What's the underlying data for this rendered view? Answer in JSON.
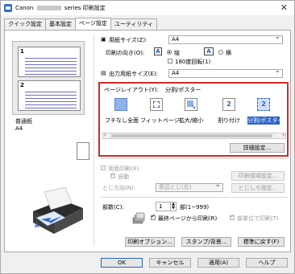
{
  "window": {
    "title_prefix": "Canon",
    "title_suffix": "series 印刷設定",
    "close": "✕"
  },
  "tabs": [
    "クイック設定",
    "基本設定",
    "ページ設定",
    "ユーティリティ"
  ],
  "preview": {
    "thumb_1": "1",
    "thumb_2": "2",
    "paper_type": "普通紙",
    "paper_size": "A4"
  },
  "page": {
    "paper_size_label": "用紙サイズ(Z):",
    "paper_size_value": "A4",
    "orientation_label": "印刷の向き(O):",
    "orientation_portrait_icon": "A",
    "orientation_portrait": "縦",
    "orientation_landscape_icon": "A",
    "orientation_landscape": "横",
    "rotate180": "180度回転(1)",
    "output_size_label": "出力用紙サイズ(E):",
    "output_size_value": "A4"
  },
  "layout": {
    "label": "ページレイアウト(Y):",
    "value": "分割/ポスター",
    "items": [
      "フチなし全面",
      "フィットページ",
      "拡大/縮小",
      "割り付け",
      "分割/ポスター"
    ],
    "item_2_num": "2",
    "item_3_num": "2",
    "details_button": "詳細設定..."
  },
  "duplex": {
    "checkbox": "両面印刷(X)",
    "auto": "自動",
    "area_button": "印刷領域設定...",
    "binding_label": "とじ方向(N):",
    "binding_value": "長辺とじ(左)",
    "margin_button": "とじしろ指定..."
  },
  "copies": {
    "label": "部数(C):",
    "value": "1",
    "range": "部(1~999)",
    "last_page_first": "最終ページから印刷(R)",
    "collate": "部単位で印刷(T)"
  },
  "buttons": {
    "print_options": "印刷オプション...",
    "stamp": "スタンプ/背景...",
    "defaults": "標準に戻す(F)",
    "ok": "OK",
    "cancel": "キャンセル",
    "apply": "適用(A)",
    "help": "ヘルプ"
  },
  "colors": {
    "accent": "#2a63c6",
    "highlight_frame": "#d12a2a"
  }
}
